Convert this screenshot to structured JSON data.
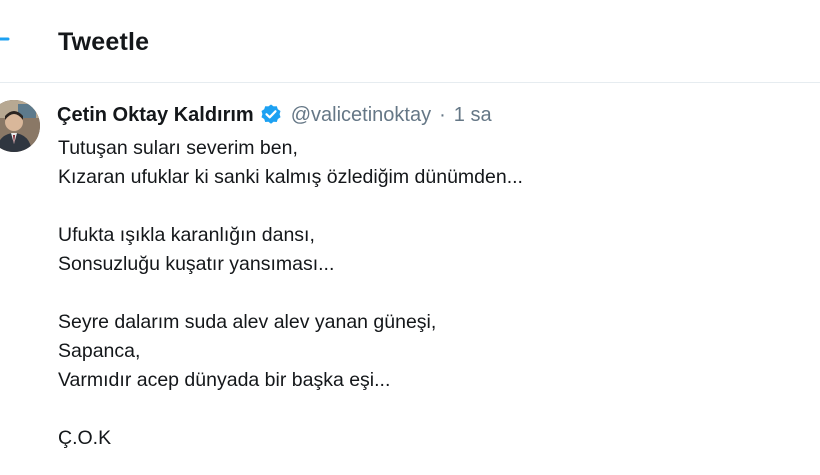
{
  "header": {
    "title": "Tweetle"
  },
  "tweet": {
    "author_name": "Çetin Oktay Kaldırım",
    "handle": "@valicetinoktay",
    "separator": "·",
    "time": "1 sa",
    "stanza1": [
      "Tutuşan suları severim ben,",
      "Kızaran ufuklar ki sanki kalmış özlediğim dünümden..."
    ],
    "stanza2": [
      "Ufukta ışıkla karanlığın dansı,",
      "Sonsuzluğu kuşatır yansıması..."
    ],
    "stanza3": [
      "Seyre dalarım suda alev alev yanan güneşi,",
      "Sapanca,",
      "Varmıdır acep dünyada bir başka eşi..."
    ],
    "signature": "Ç.O.K"
  },
  "colors": {
    "accent": "#1da1f2",
    "text": "#14171a",
    "muted": "#657786",
    "divider": "#e6ecf0"
  },
  "icons": {
    "back": "back-arrow-icon",
    "verified": "verified-badge-icon"
  }
}
